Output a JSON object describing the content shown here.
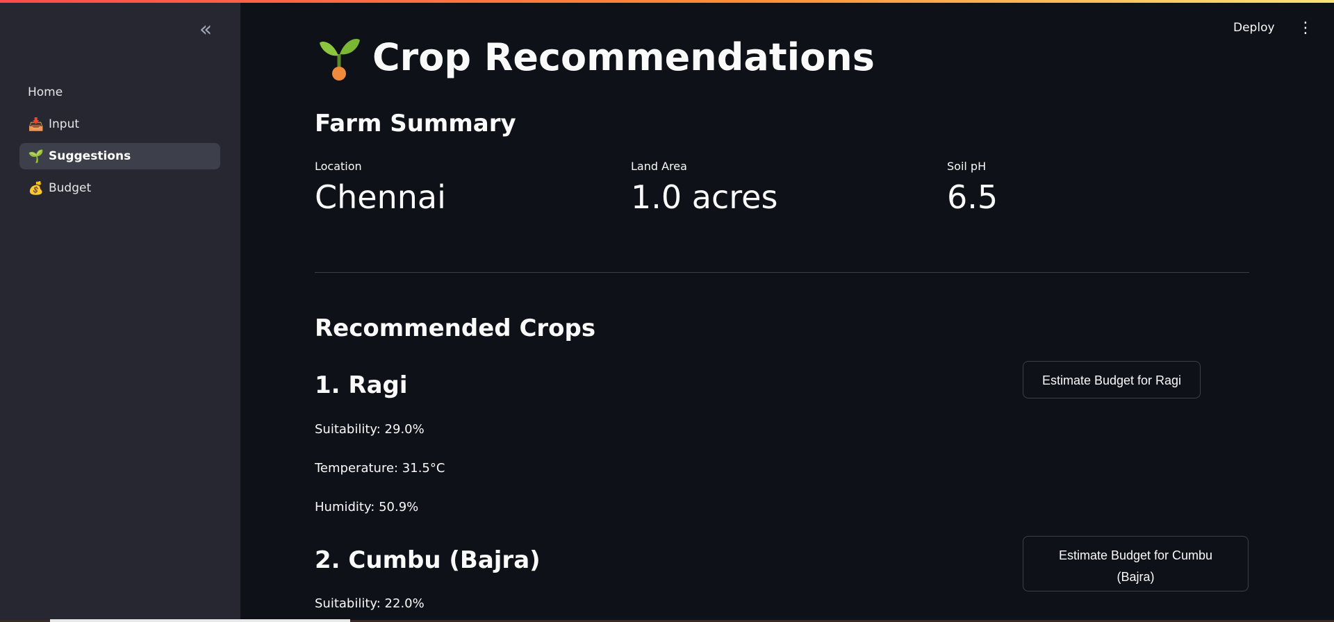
{
  "app": {
    "deploy_label": "Deploy"
  },
  "sidebar": {
    "items": [
      {
        "label": "Home",
        "icon": "",
        "active": false
      },
      {
        "label": "Input",
        "icon": "📥",
        "active": false
      },
      {
        "label": "Suggestions",
        "icon": "🌱",
        "active": true
      },
      {
        "label": "Budget",
        "icon": "💰",
        "active": false
      }
    ]
  },
  "page": {
    "title": "Crop Recommendations",
    "title_icon": "seedling-icon"
  },
  "farm_summary": {
    "heading": "Farm Summary",
    "metrics": [
      {
        "label": "Location",
        "value": "Chennai"
      },
      {
        "label": "Land Area",
        "value": "1.0 acres"
      },
      {
        "label": "Soil pH",
        "value": "6.5"
      }
    ]
  },
  "recommended": {
    "heading": "Recommended Crops",
    "crops": [
      {
        "title": "1. Ragi",
        "suitability": "Suitability: 29.0%",
        "temperature": "Temperature: 31.5°C",
        "humidity": "Humidity: 50.9%",
        "button_label": "Estimate Budget for Ragi"
      },
      {
        "title": "2. Cumbu (Bajra)",
        "suitability": "Suitability: 22.0%",
        "button_line1": "Estimate Budget for Cumbu",
        "button_line2": "(Bajra)"
      }
    ]
  },
  "colors": {
    "background": "#0e1117",
    "sidebar": "#262730",
    "accent": "#ff4b4b",
    "text": "#fafafa"
  }
}
